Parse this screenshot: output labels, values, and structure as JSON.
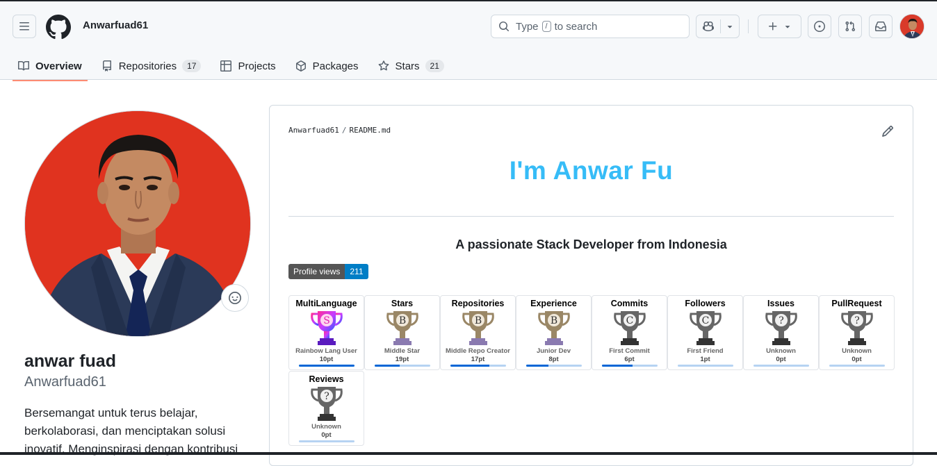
{
  "header": {
    "username": "Anwarfuad61"
  },
  "search": {
    "text_before": "Type",
    "key": "/",
    "text_after": "to search"
  },
  "tabs": [
    {
      "label": "Overview",
      "count": ""
    },
    {
      "label": "Repositories",
      "count": "17"
    },
    {
      "label": "Projects",
      "count": ""
    },
    {
      "label": "Packages",
      "count": ""
    },
    {
      "label": "Stars",
      "count": "21"
    }
  ],
  "profile": {
    "full_name": "anwar fuad",
    "login": "Anwarfuad61",
    "bio": "Bersemangat untuk terus belajar, berkolaborasi, dan menciptakan solusi inovatif. Menginspirasi dengan kontribusi"
  },
  "readme": {
    "owner": "Anwarfuad61",
    "file": "README.md",
    "heading": "I'm Anwar Fu",
    "tagline": "A passionate Stack Developer from Indonesia",
    "views_label": "Profile views",
    "views_count": "211"
  },
  "trophies": [
    {
      "title": "MultiLanguage",
      "rank": "S",
      "name": "Rainbow Lang User",
      "points": "10pt",
      "progress": 1.0,
      "theme": "rainbow"
    },
    {
      "title": "Stars",
      "rank": "B",
      "name": "Middle Star",
      "points": "19pt",
      "progress": 0.45,
      "theme": "bronze"
    },
    {
      "title": "Repositories",
      "rank": "B",
      "name": "Middle Repo Creator",
      "points": "17pt",
      "progress": 0.7,
      "theme": "bronze"
    },
    {
      "title": "Experience",
      "rank": "B",
      "name": "Junior Dev",
      "points": "8pt",
      "progress": 0.4,
      "theme": "bronze"
    },
    {
      "title": "Commits",
      "rank": "C",
      "name": "First Commit",
      "points": "6pt",
      "progress": 0.55,
      "theme": "gray"
    },
    {
      "title": "Followers",
      "rank": "C",
      "name": "First Friend",
      "points": "1pt",
      "progress": 0.0,
      "theme": "gray"
    },
    {
      "title": "Issues",
      "rank": "?",
      "name": "Unknown",
      "points": "0pt",
      "progress": 0.0,
      "theme": "gray"
    },
    {
      "title": "PullRequest",
      "rank": "?",
      "name": "Unknown",
      "points": "0pt",
      "progress": 0.0,
      "theme": "gray"
    },
    {
      "title": "Reviews",
      "rank": "?",
      "name": "Unknown",
      "points": "0pt",
      "progress": 0.0,
      "theme": "gray"
    }
  ],
  "colors": {
    "accent_tab": "#fd8c73",
    "heading": "#36bcf7",
    "views_badge": "#007ec6"
  }
}
